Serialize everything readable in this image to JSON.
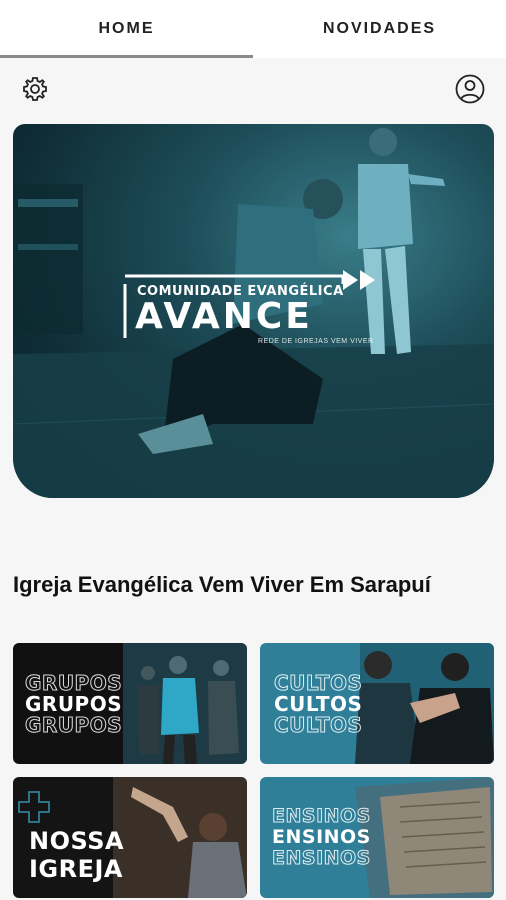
{
  "tabs": [
    {
      "label": "HOME",
      "active": true
    },
    {
      "label": "NOVIDADES",
      "active": false
    }
  ],
  "header": {
    "settings_icon": "gear-icon",
    "profile_icon": "user-circle-icon"
  },
  "hero": {
    "logo_top": "COMUNIDADE EVANGÉLICA",
    "logo_main": "AVANCE",
    "logo_sub": "REDE DE IGREJAS VEM VIVER"
  },
  "section": {
    "title": "Igreja Evangélica Vem Viver Em Sarapuí"
  },
  "cards": [
    {
      "label": "GRUPOS",
      "bg": "#111111"
    },
    {
      "label": "CULTOS",
      "bg": "#2f7f98"
    },
    {
      "label_line1": "NOSSA",
      "label_line2": "IGREJA",
      "bg": "#141414"
    },
    {
      "label": "ENSINOS",
      "bg": "#2f7f98"
    }
  ],
  "colors": {
    "accent_teal": "#2f7f98",
    "tab_indicator": "#8a8a8a"
  }
}
